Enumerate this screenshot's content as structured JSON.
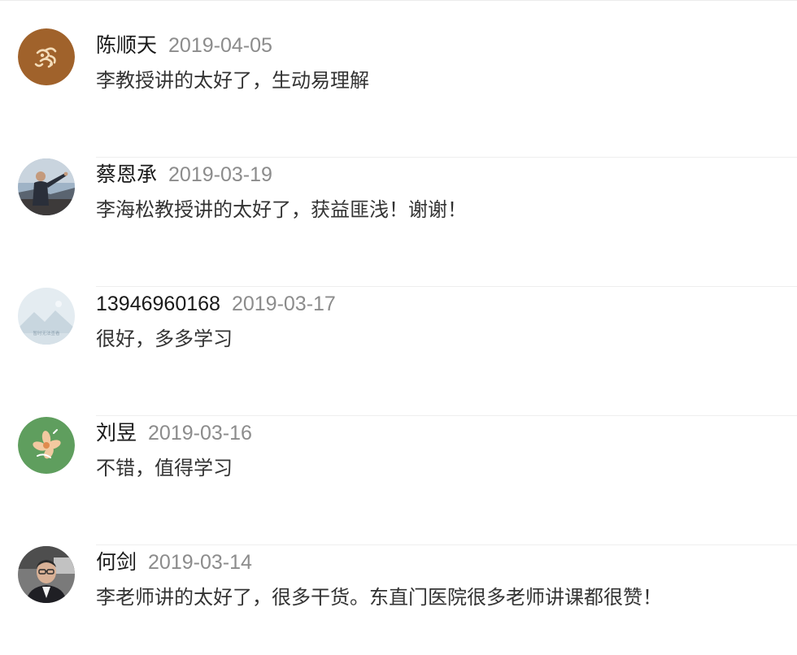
{
  "comments": [
    {
      "name": "陈顺天",
      "date": "2019-04-05",
      "text": "李教授讲的太好了，生动易理解",
      "avatar_icon": "tan-ornament-avatar",
      "avatar_color": "#a0622b"
    },
    {
      "name": "蔡恩承",
      "date": "2019-03-19",
      "text": "李海松教授讲的太好了，获益匪浅！谢谢！",
      "avatar_icon": "photo-man-pointing-avatar",
      "avatar_color": "#8aa2b8"
    },
    {
      "name": "13946960168",
      "date": "2019-03-17",
      "text": "很好，多多学习",
      "avatar_icon": "placeholder-mountain-avatar",
      "avatar_color": "#dfe8ee",
      "avatar_caption": "暂时无法查看"
    },
    {
      "name": "刘昱",
      "date": "2019-03-16",
      "text": "不错，值得学习",
      "avatar_icon": "green-flower-avatar",
      "avatar_color": "#5f9e5e"
    },
    {
      "name": "何剑",
      "date": "2019-03-14",
      "text": "李老师讲的太好了，很多干货。东直门医院很多老师讲课都很赞！",
      "avatar_icon": "photo-man-glasses-avatar",
      "avatar_color": "#6a6a6a"
    }
  ]
}
